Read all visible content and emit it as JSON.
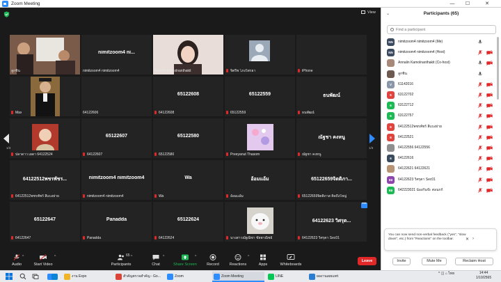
{
  "window": {
    "title": "Zoom Meeting",
    "min": "—",
    "max": "☐",
    "close": "✕"
  },
  "view_label": "View",
  "pagination": {
    "left": "1/3",
    "right": "1/3"
  },
  "more_dots": "•••",
  "tiles": [
    {
      "name": "ลูกชิ้น",
      "center": "",
      "muted": false,
      "active": true,
      "kind": "photo-man"
    },
    {
      "name": "nimitzoom4  nimitzoom4",
      "center": "nimitzoom4  ni...",
      "muted": false,
      "kind": "text"
    },
    {
      "name": "Annalin Kamolnanthakit",
      "center": "",
      "muted": false,
      "kind": "photo-woman"
    },
    {
      "name": "จิตรีพ โภงไพรยา",
      "center": "",
      "muted": true,
      "kind": "avatar"
    },
    {
      "name": "iPhone",
      "center": "",
      "muted": true,
      "kind": "blank"
    },
    {
      "name": "Max",
      "center": "",
      "muted": true,
      "kind": "photo-grad"
    },
    {
      "name": "64122606",
      "center": "",
      "muted": false,
      "kind": "blank"
    },
    {
      "name": "64122608",
      "center": "65122608",
      "muted": true,
      "kind": "text"
    },
    {
      "name": "65122559",
      "center": "65122559",
      "muted": true,
      "kind": "text"
    },
    {
      "name": "ธนพัฒน์",
      "center": "ธนพัฒน์",
      "muted": true,
      "kind": "text"
    },
    {
      "name": "ปลาดาว เผดา 64122524",
      "center": "",
      "muted": true,
      "kind": "photo-red"
    },
    {
      "name": "64122607",
      "center": "65122607",
      "muted": true,
      "kind": "text"
    },
    {
      "name": "65122580",
      "center": "65122580",
      "muted": true,
      "kind": "text"
    },
    {
      "name": "Preeyanut Thasom",
      "center": "",
      "muted": true,
      "kind": "photo-pink"
    },
    {
      "name": "ณัฐชา คงหนู",
      "center": "ณัฐชา คงหนู",
      "muted": true,
      "kind": "text"
    },
    {
      "name": "64122512พชรพัชร์ สีแบงย่าย",
      "center": "64122512พชรพัชร...",
      "muted": true,
      "kind": "text"
    },
    {
      "name": "nimitzoom4  nimitzoom4",
      "center": "nimitzoom4 nimitzoom4",
      "muted": true,
      "kind": "text"
    },
    {
      "name": "Wa",
      "center": "Wa",
      "muted": true,
      "kind": "text"
    },
    {
      "name": "อ้อมแอ้ม",
      "center": "อ้อมแอ้ม",
      "muted": true,
      "kind": "text"
    },
    {
      "name": "65122659จิตติภาส คิดถึงใหญ่",
      "center": "65122659จิตติภา...",
      "muted": true,
      "kind": "text"
    },
    {
      "name": "64122647",
      "center": "65122647",
      "muted": true,
      "kind": "text"
    },
    {
      "name": "Panadda",
      "center": "Panadda",
      "muted": true,
      "kind": "text"
    },
    {
      "name": "64122624",
      "center": "65122624",
      "muted": true,
      "kind": "text"
    },
    {
      "name": "นางสาวณัฐณิชา ชัยพาณิชย์",
      "center": "",
      "muted": true,
      "kind": "photo-seal"
    },
    {
      "name": "64122623 วิศรุตา Sec01",
      "center": "64122623 วิศรุต...",
      "muted": true,
      "kind": "text"
    }
  ],
  "toolbar": {
    "audio": "Audio",
    "start_video": "Start Video",
    "participants": "Participants",
    "participants_count": "65",
    "chat": "Chat",
    "share_screen": "Share Screen",
    "record": "Record",
    "reactions": "Reactions",
    "apps": "Apps",
    "whiteboards": "Whiteboards",
    "leave": "Leave"
  },
  "panel": {
    "title": "Participants (65)",
    "collapse": "⌄",
    "search_placeholder": "Find a participant",
    "participants": [
      {
        "initials": "NN",
        "color": "#3b4a5e",
        "name": "nimitzoom4  nimitzoom4 (Me)",
        "muted": false,
        "video_off": false
      },
      {
        "initials": "NN",
        "color": "#3b4a5e",
        "name": "nimitzoom4  nimitzoom4 (Host)",
        "muted": true,
        "video_off": true
      },
      {
        "initials": "",
        "color": "#a7897a",
        "name": "Annalin Kamolnanthakit (Co-host)",
        "muted": false,
        "video_off": true
      },
      {
        "initials": "",
        "color": "#6d5a50",
        "name": "ลูกชิ้น",
        "muted": false,
        "video_off": false
      },
      {
        "initials": "V",
        "color": "#8a97a8",
        "name": "61142016",
        "muted": true,
        "video_off": true
      },
      {
        "initials": "6",
        "color": "#e0443e",
        "name": "63122702",
        "muted": true,
        "video_off": true
      },
      {
        "initials": "6",
        "color": "#1db954",
        "name": "63122712",
        "muted": true,
        "video_off": true
      },
      {
        "initials": "6",
        "color": "#1db954",
        "name": "63122757",
        "muted": true,
        "video_off": true
      },
      {
        "initials": "6",
        "color": "#e0443e",
        "name": "64122512พชรพัชร์ สีแบงย่าย",
        "muted": true,
        "video_off": true
      },
      {
        "initials": "6",
        "color": "#e0443e",
        "name": "64122521",
        "muted": true,
        "video_off": true
      },
      {
        "initials": "",
        "color": "#8f8f8f",
        "name": "64122556 64122556",
        "muted": true,
        "video_off": true
      },
      {
        "initials": "6",
        "color": "#3b4a5e",
        "name": "64122616",
        "muted": true,
        "video_off": true
      },
      {
        "initials": "",
        "color": "#b89474",
        "name": "64122621 64122621",
        "muted": true,
        "video_off": true
      },
      {
        "initials": "6ล",
        "color": "#8e44ad",
        "name": "64122623 วิศรุตา Sec01",
        "muted": true,
        "video_off": true
      },
      {
        "initials": "6ล",
        "color": "#1db954",
        "name": "642223021 น้องกันจ๊ะ ค่อนกก้",
        "muted": true,
        "video_off": true
      }
    ],
    "toast": "You can now send non-verbal feedback (\"yes\", \"slow down\", etc.) from \"Reactions\" on the toolbar.",
    "toast_close": "✕",
    "toast_more": "›",
    "invite": "Invite",
    "mute_me": "Mute Me",
    "reclaim_host": "Reclaim Host"
  },
  "taskbar": {
    "items": [
      {
        "label": "",
        "color": "#2d8cff"
      },
      {
        "label": "",
        "color": "#0a84d6"
      },
      {
        "label": "งาน Expo",
        "color": "#f0b429"
      },
      {
        "label": "สำคัญตรวจสำคัญ - Go...",
        "color": "#db4437"
      },
      {
        "label": "Zoom",
        "color": "#2d8cff"
      },
      {
        "label": "Zoom Meeting",
        "color": "#2d8cff"
      },
      {
        "label": "LINE",
        "color": "#06c755"
      },
      {
        "label": "ผลงานเผยแพร่",
        "color": "#2b7cd3"
      }
    ],
    "tray": "^  ◫  ⌂  ไทย",
    "time": "14:44",
    "date": "1/10/2565"
  }
}
